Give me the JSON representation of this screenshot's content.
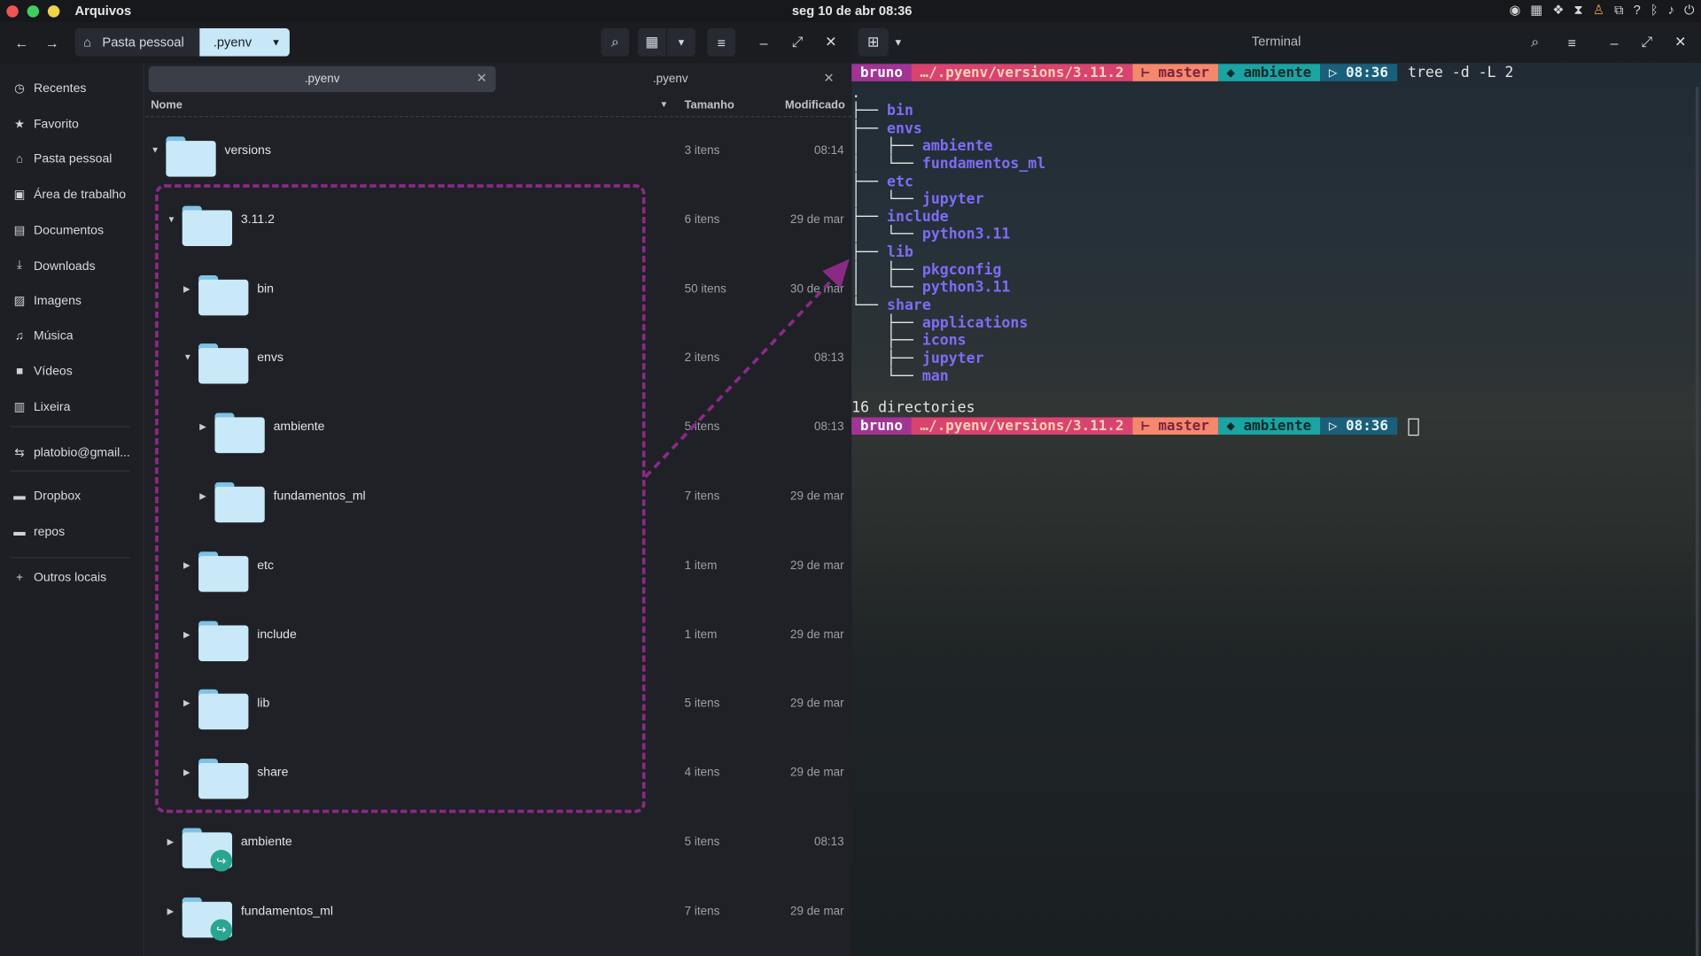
{
  "topbar": {
    "app_title": "Arquivos",
    "clock": "seg 10 de abr  08:36",
    "traffic_colors": [
      "#f05454",
      "#3ecf5c",
      "#f0d44a"
    ]
  },
  "filemanager": {
    "breadcrumb": {
      "home": "Pasta pessoal",
      "current": ".pyenv"
    },
    "sidebar": [
      {
        "icon": "clock-icon",
        "glyph": "◷",
        "label": "Recentes"
      },
      {
        "icon": "star-icon",
        "glyph": "★",
        "label": "Favorito"
      },
      {
        "icon": "home-icon",
        "glyph": "⌂",
        "label": "Pasta pessoal"
      },
      {
        "icon": "desktop-icon",
        "glyph": "▣",
        "label": "Área de trabalho"
      },
      {
        "icon": "document-icon",
        "glyph": "▤",
        "label": "Documentos"
      },
      {
        "icon": "download-icon",
        "glyph": "⤓",
        "label": "Downloads"
      },
      {
        "icon": "image-icon",
        "glyph": "▨",
        "label": "Imagens"
      },
      {
        "icon": "music-icon",
        "glyph": "♫",
        "label": "Música"
      },
      {
        "icon": "video-icon",
        "glyph": "■",
        "label": "Vídeos"
      },
      {
        "icon": "trash-icon",
        "glyph": "▥",
        "label": "Lixeira"
      },
      {
        "icon": "network-icon",
        "glyph": "⇆",
        "label": "platobio@gmail..."
      },
      {
        "icon": "folder-icon",
        "glyph": "▬",
        "label": "Dropbox"
      },
      {
        "icon": "folder-icon",
        "glyph": "▬",
        "label": "repos"
      },
      {
        "icon": "plus-icon",
        "glyph": "+",
        "label": "Outros locais"
      }
    ],
    "tabs": [
      ".pyenv",
      ".pyenv"
    ],
    "columns": {
      "name": "Nome",
      "size": "Tamanho",
      "modified": "Modificado"
    },
    "rows": [
      {
        "name": "versions",
        "size": "3 itens",
        "modified": "08:14",
        "level": 0,
        "expanded": true,
        "link": false
      },
      {
        "name": "3.11.2",
        "size": "6 itens",
        "modified": "29 de mar",
        "level": 1,
        "expanded": true,
        "link": false
      },
      {
        "name": "bin",
        "size": "50 itens",
        "modified": "30 de mar",
        "level": 2,
        "expanded": false,
        "link": false
      },
      {
        "name": "envs",
        "size": "2 itens",
        "modified": "08:13",
        "level": 2,
        "expanded": true,
        "link": false
      },
      {
        "name": "ambiente",
        "size": "5 itens",
        "modified": "08:13",
        "level": 3,
        "expanded": false,
        "link": false
      },
      {
        "name": "fundamentos_ml",
        "size": "7 itens",
        "modified": "29 de mar",
        "level": 3,
        "expanded": false,
        "link": false
      },
      {
        "name": "etc",
        "size": "1 item",
        "modified": "29 de mar",
        "level": 2,
        "expanded": false,
        "link": false
      },
      {
        "name": "include",
        "size": "1 item",
        "modified": "29 de mar",
        "level": 2,
        "expanded": false,
        "link": false
      },
      {
        "name": "lib",
        "size": "5 itens",
        "modified": "29 de mar",
        "level": 2,
        "expanded": false,
        "link": false
      },
      {
        "name": "share",
        "size": "4 itens",
        "modified": "29 de mar",
        "level": 2,
        "expanded": false,
        "link": false
      },
      {
        "name": "ambiente",
        "size": "5 itens",
        "modified": "08:13",
        "level": 1,
        "expanded": false,
        "link": true
      },
      {
        "name": "fundamentos_ml",
        "size": "7 itens",
        "modified": "29 de mar",
        "level": 1,
        "expanded": false,
        "link": true
      }
    ]
  },
  "terminal": {
    "title": "Terminal",
    "prompt": {
      "user": "bruno",
      "path": "…/.pyenv/versions/3.11.2",
      "branch": "⊢ master",
      "env": "◆  ambiente",
      "time": "▷ 08:36",
      "colors": {
        "user": "#a23496",
        "path": "#d9436f",
        "branch": "#f5876d",
        "env": "#1aa4a4",
        "time": "#1a5f7a"
      }
    },
    "command": "tree -d -L 2",
    "tree": [
      {
        "prefix": ".",
        "name": ""
      },
      {
        "prefix": "├── ",
        "name": "bin"
      },
      {
        "prefix": "├── ",
        "name": "envs"
      },
      {
        "prefix": "│   ├── ",
        "name": "ambiente"
      },
      {
        "prefix": "│   └── ",
        "name": "fundamentos_ml"
      },
      {
        "prefix": "├── ",
        "name": "etc"
      },
      {
        "prefix": "│   └── ",
        "name": "jupyter"
      },
      {
        "prefix": "├── ",
        "name": "include"
      },
      {
        "prefix": "│   └── ",
        "name": "python3.11"
      },
      {
        "prefix": "├── ",
        "name": "lib"
      },
      {
        "prefix": "│   ├── ",
        "name": "pkgconfig"
      },
      {
        "prefix": "│   └── ",
        "name": "python3.11"
      },
      {
        "prefix": "└── ",
        "name": "share"
      },
      {
        "prefix": "    ├── ",
        "name": "applications"
      },
      {
        "prefix": "    ├── ",
        "name": "icons"
      },
      {
        "prefix": "    ├── ",
        "name": "jupyter"
      },
      {
        "prefix": "    └── ",
        "name": "man"
      }
    ],
    "summary": "16 directories"
  },
  "annotation": {
    "color": "#8a2a86"
  }
}
